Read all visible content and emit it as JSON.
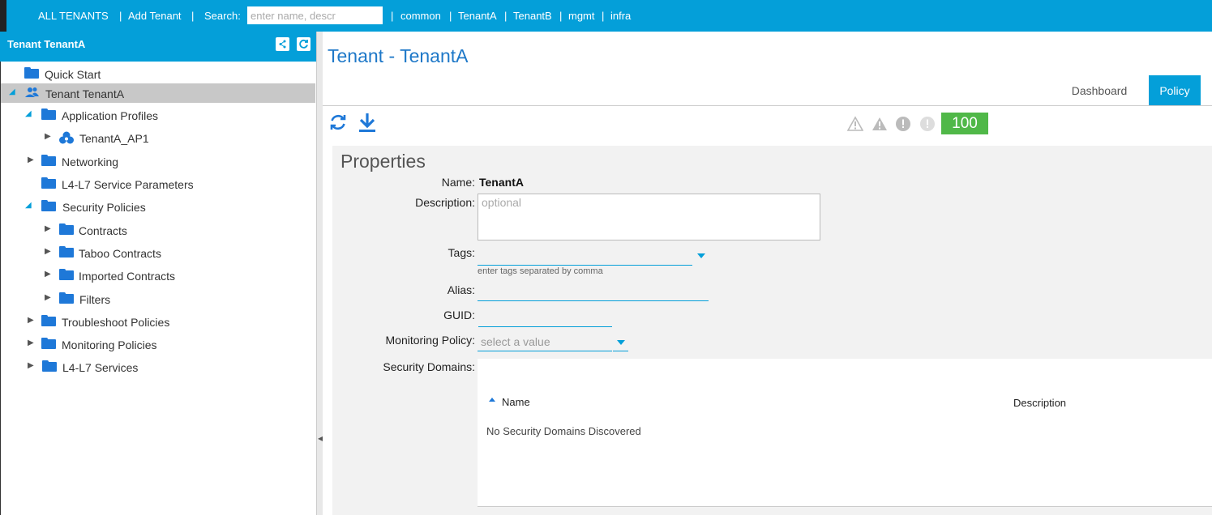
{
  "topbar": {
    "all_tenants": "ALL TENANTS",
    "add_tenant": "Add Tenant",
    "search_label": "Search:",
    "search_placeholder": "enter name, descr",
    "tenants": [
      "common",
      "TenantA",
      "TenantB",
      "mgmt",
      "infra"
    ],
    "bar_color": "#049fd9"
  },
  "sidebar": {
    "title": "Tenant TenantA",
    "items": [
      {
        "label": "Quick Start"
      },
      {
        "label": "Tenant TenantA"
      },
      {
        "label": "Application Profiles"
      },
      {
        "label": "TenantA_AP1"
      },
      {
        "label": "Networking"
      },
      {
        "label": "L4-L7 Service Parameters"
      },
      {
        "label": "Security Policies"
      },
      {
        "label": "Contracts"
      },
      {
        "label": "Taboo Contracts"
      },
      {
        "label": "Imported Contracts"
      },
      {
        "label": "Filters"
      },
      {
        "label": "Troubleshoot Policies"
      },
      {
        "label": "Monitoring Policies"
      },
      {
        "label": "L4-L7 Services"
      }
    ]
  },
  "main": {
    "title": "Tenant - TenantA",
    "tabs": [
      {
        "label": "Dashboard"
      },
      {
        "label": "Policy"
      }
    ],
    "health_score": "100",
    "properties": {
      "heading": "Properties",
      "name_label": "Name:",
      "name_value": "TenantA",
      "description_label": "Description:",
      "description_placeholder": "optional",
      "tags_label": "Tags:",
      "tags_help": "enter tags separated by comma",
      "alias_label": "Alias:",
      "guid_label": "GUID:",
      "monitoring_label": "Monitoring Policy:",
      "monitoring_placeholder": "select a value",
      "security_domains_label": "Security Domains:",
      "table_columns": [
        "Name",
        "Description"
      ],
      "table_empty": "No Security Domains Discovered"
    }
  }
}
